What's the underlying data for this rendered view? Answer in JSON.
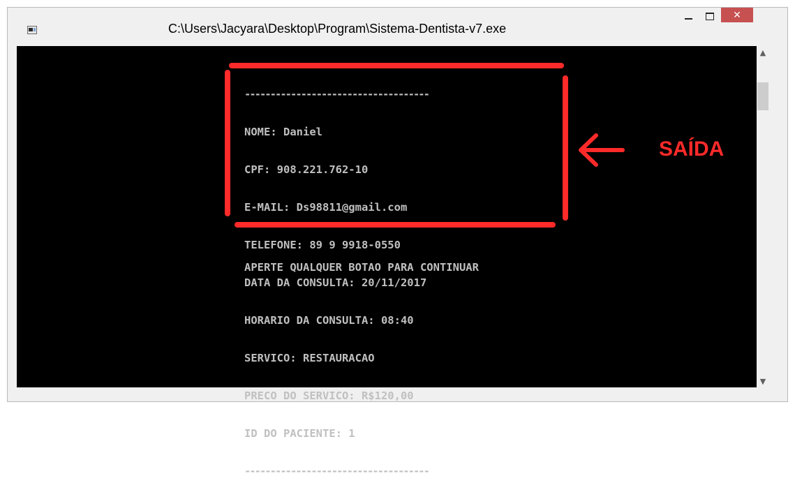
{
  "window": {
    "title": "C:\\Users\\Jacyara\\Desktop\\Program\\Sistema-Dentista-v7.exe",
    "icon": "console-app-icon",
    "controls": {
      "minimize": "minimize-icon",
      "maximize": "maximize-icon",
      "close_glyph": "✕"
    }
  },
  "console": {
    "background": "#000000",
    "text_color": "#c0c0c0",
    "separator_top": "------------------------------------",
    "lines": [
      "NOME: Daniel",
      "CPF: 908.221.762-10",
      "E-MAIL: Ds98811@gmail.com",
      "TELEFONE: 89 9 9918-0550",
      "DATA DA CONSULTA: 20/11/2017",
      "HORARIO DA CONSULTA: 08:40",
      "SERVICO: RESTAURACAO",
      "PRECO DO SERVICO: R$120,00",
      "ID DO PACIENTE: 1"
    ],
    "separator_bottom": "------------------------------------",
    "prompt": "APERTE QUALQUER BOTAO PARA CONTINUAR"
  },
  "annotation": {
    "label": "SAÍDA",
    "color": "#ff2a2a",
    "arrow_icon": "left-arrow-icon"
  },
  "scrollbar": {
    "up": "▲",
    "down": "▼"
  }
}
